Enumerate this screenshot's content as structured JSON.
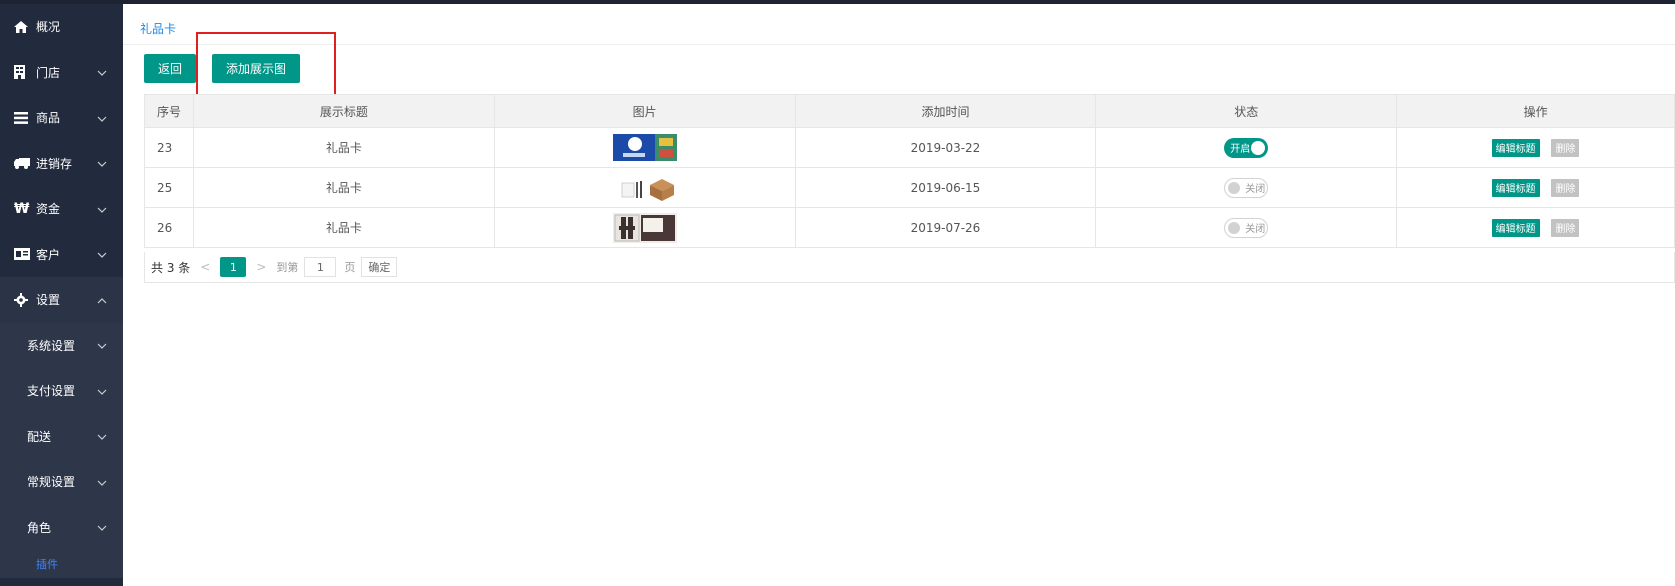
{
  "sidebar": {
    "items": [
      {
        "label": "概况",
        "icon": "home-icon"
      },
      {
        "label": "门店",
        "icon": "store-icon"
      },
      {
        "label": "商品",
        "icon": "list-icon"
      },
      {
        "label": "进销存",
        "icon": "truck-icon"
      },
      {
        "label": "资金",
        "icon": "won-currency-icon"
      },
      {
        "label": "客户",
        "icon": "id-card-icon"
      },
      {
        "label": "设置",
        "icon": "gear-icon"
      }
    ],
    "sub_items": [
      {
        "label": "系统设置"
      },
      {
        "label": "支付设置"
      },
      {
        "label": "配送"
      },
      {
        "label": "常规设置"
      },
      {
        "label": "角色"
      }
    ],
    "plugin_label": "插件"
  },
  "breadcrumb": {
    "label": "礼品卡"
  },
  "toolbar": {
    "back_label": "返回",
    "add_label": "添加展示图"
  },
  "table": {
    "headers": [
      "序号",
      "展示标题",
      "图片",
      "添加时间",
      "状态",
      "操作"
    ],
    "rows": [
      {
        "id": "23",
        "title": "礼品卡",
        "date": "2019-03-22",
        "status": "开启",
        "on": true
      },
      {
        "id": "25",
        "title": "礼品卡",
        "date": "2019-06-15",
        "status": "关闭",
        "on": false
      },
      {
        "id": "26",
        "title": "礼品卡",
        "date": "2019-07-26",
        "status": "关闭",
        "on": false
      }
    ],
    "edit_label": "编辑标题",
    "delete_label": "删除"
  },
  "pager": {
    "total": "共 3 条",
    "current": "1",
    "goto_label": "到第",
    "page_input": "1",
    "page_unit": "页",
    "confirm_label": "确定"
  },
  "colors": {
    "accent": "#009688",
    "sidebar": "#222a3d",
    "link": "#1e88e5",
    "highlight": "#e02020"
  }
}
